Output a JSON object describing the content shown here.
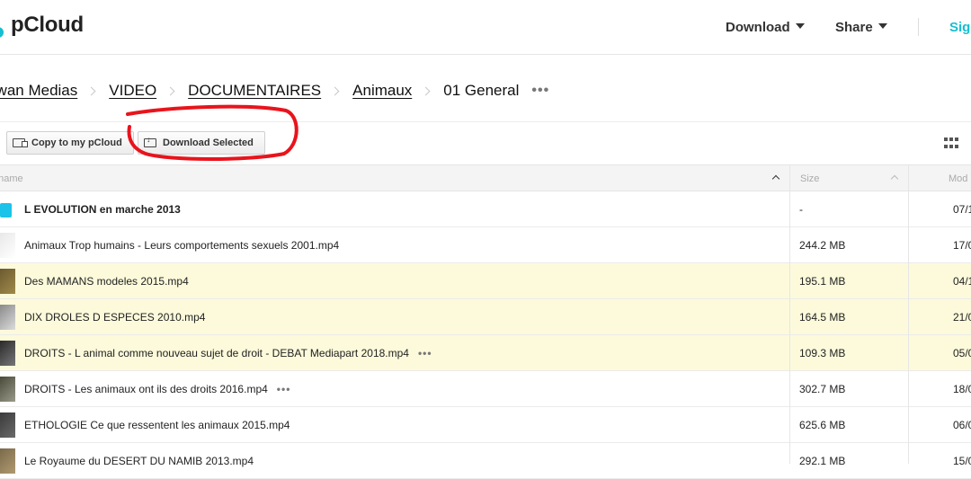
{
  "header": {
    "logo_text": "pCloud",
    "nav": [
      {
        "label": "Download"
      },
      {
        "label": "Share"
      }
    ],
    "signin_label": "Sign"
  },
  "breadcrumb": {
    "items": [
      "ijwan Medias",
      "VIDEO",
      "DOCUMENTAIRES",
      "Animaux"
    ],
    "current": "01 General",
    "more": "•••"
  },
  "toolbar": {
    "copy_label": "Copy to my pCloud",
    "download_label": "Download Selected"
  },
  "table": {
    "headers": {
      "name": "ename",
      "size": "Size",
      "modified": "Mod"
    },
    "rows": [
      {
        "name": "L EVOLUTION en marche 2013",
        "size": "-",
        "date": "07/1",
        "type": "folder",
        "selected": false,
        "dots": false
      },
      {
        "name": "Animaux Trop humains - Leurs comportements sexuels 2001.mp4",
        "size": "244.2 MB",
        "date": "17/0",
        "type": "video",
        "selected": false,
        "dots": false
      },
      {
        "name": "Des MAMANS modeles 2015.mp4",
        "size": "195.1 MB",
        "date": "04/1",
        "type": "video",
        "selected": true,
        "dots": false
      },
      {
        "name": "DIX DROLES D ESPECES 2010.mp4",
        "size": "164.5 MB",
        "date": "21/0",
        "type": "video",
        "selected": true,
        "dots": false
      },
      {
        "name": "DROITS - L animal comme nouveau sujet de droit - DEBAT Mediapart 2018.mp4",
        "size": "109.3 MB",
        "date": "05/0",
        "type": "video",
        "selected": true,
        "dots": true
      },
      {
        "name": "DROITS - Les animaux ont ils des droits 2016.mp4",
        "size": "302.7 MB",
        "date": "18/0",
        "type": "video",
        "selected": false,
        "dots": true
      },
      {
        "name": "ETHOLOGIE Ce que ressentent les animaux 2015.mp4",
        "size": "625.6 MB",
        "date": "06/0",
        "type": "video",
        "selected": false,
        "dots": false
      },
      {
        "name": "Le Royaume du DESERT DU NAMIB 2013.mp4",
        "size": "292.1 MB",
        "date": "15/0",
        "type": "video",
        "selected": false,
        "dots": false
      }
    ]
  },
  "colors": {
    "accent": "#17bed0",
    "folder": "#1bc3e8",
    "selected_row": "#fcfadb",
    "annotation": "#e8141c"
  }
}
